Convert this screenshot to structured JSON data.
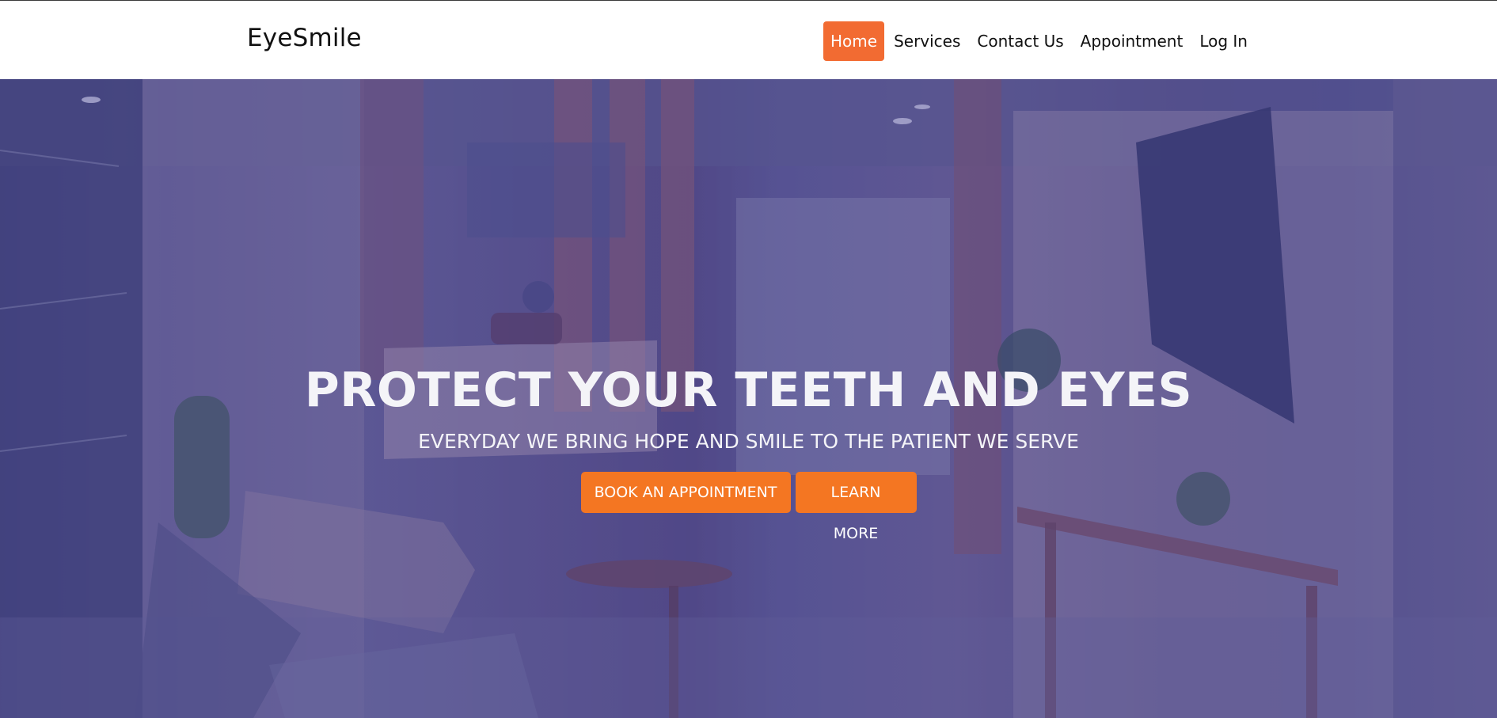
{
  "brand": {
    "name": "EyeSmile"
  },
  "nav": {
    "items": [
      {
        "label": "Home",
        "active": true
      },
      {
        "label": "Services",
        "active": false
      },
      {
        "label": "Contact Us",
        "active": false
      },
      {
        "label": "Appointment",
        "active": false
      },
      {
        "label": "Log In",
        "active": false
      }
    ]
  },
  "hero": {
    "title": "PROTECT YOUR TEETH AND EYES",
    "subtitle": "EVERYDAY WE BRING HOPE AND SMILE TO THE PATIENT WE SERVE",
    "primary_button": "BOOK AN APPOINTMENT",
    "secondary_button": "LEARN MORE",
    "background_image": "clinic-reception-photo"
  },
  "colors": {
    "accent": "#f26b32",
    "button": "#f47622",
    "hero_overlay": "#4a4696",
    "text_dark": "#111111",
    "text_light": "#ffffff"
  }
}
